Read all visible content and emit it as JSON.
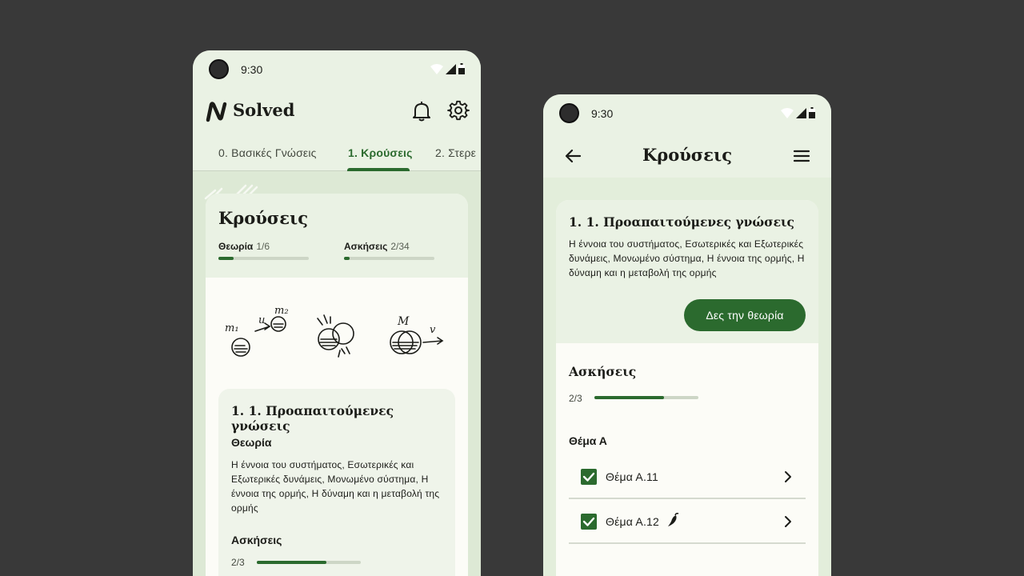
{
  "status": {
    "time": "9:30"
  },
  "phone1": {
    "app_title": "Solved",
    "tabs": [
      "0. Βασικές Γνώσεις",
      "1. Κρούσεις",
      "2. Στερε"
    ],
    "card": {
      "title": "Κρούσεις",
      "theory_label": "Θεωρία",
      "theory_count": "1/6",
      "theory_progress": 0.17,
      "exercises_label": "Ασκήσεις",
      "exercises_count": "2/34",
      "exercises_progress": 0.06,
      "sketch_labels": {
        "m1": "m₁",
        "u": "u",
        "m2": "m₂",
        "M": "M",
        "v": "v"
      }
    },
    "subcard": {
      "title": "1. 1. Προαπαιτούμενες γνώσεις",
      "theory_heading": "Θεωρία",
      "theory_text": "Η έννοια του συστήματος, Εσωτερικές και Εξωτερικές δυνάμεις, Μονωμένο σύστημα, Η έννοια της ορμής, Η δύναμη και η μεταβολή της ορμής",
      "exercises_heading": "Ασκήσεις",
      "exercises_count": "2/3",
      "exercises_progress": 0.67
    }
  },
  "phone2": {
    "title": "Κρούσεις",
    "section_title": "1. 1. Προαπαιτούμενες γνώσεις",
    "section_text": "Η έννοια του συστήματος, Εσωτερικές και Εξωτερικές δυνάμεις, Μονωμένο σύστημα, Η έννοια της ορμής, Η δύναμη και η μεταβολή της ορμής",
    "theory_button": "Δες την θεωρία",
    "exercises_title": "Ασκήσεις",
    "exercises_count": "2/3",
    "exercises_progress": 0.67,
    "topic_title": "Θέμα Α",
    "items": [
      {
        "label": "Θέμα Α.11",
        "checked": true,
        "hot": false
      },
      {
        "label": "Θέμα Α.12",
        "checked": true,
        "hot": true
      }
    ]
  },
  "icons": [
    "wifi-icon",
    "signal-icon",
    "battery-icon",
    "bell-icon",
    "gear-icon",
    "back-arrow-icon",
    "menu-icon",
    "check-icon",
    "chevron-right-icon",
    "chili-pepper-icon"
  ],
  "colors": {
    "primary": "#2b6a2e",
    "surface": "#eaf2e4",
    "background": "#dde9d5",
    "card": "#fcfcf7"
  }
}
